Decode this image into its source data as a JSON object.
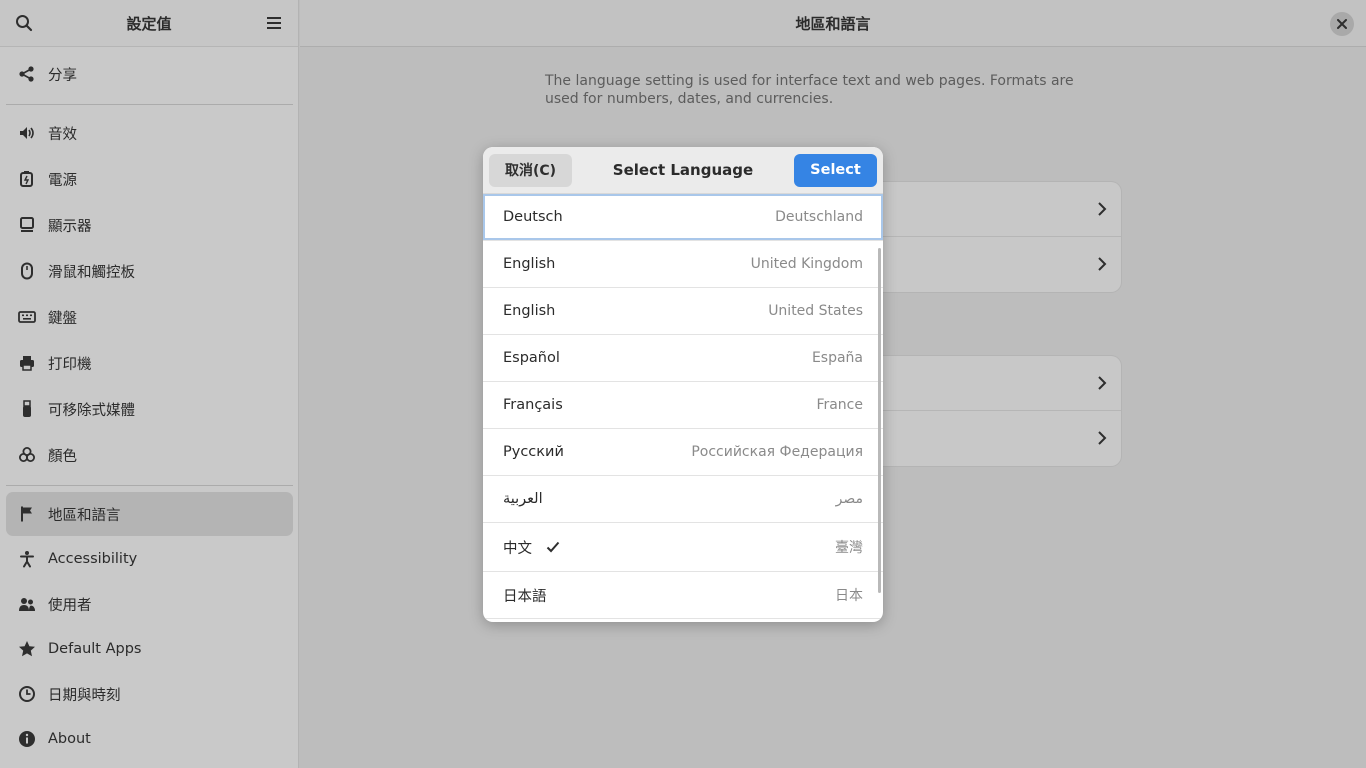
{
  "sidebar": {
    "title": "設定值",
    "items": [
      {
        "label": "分享",
        "icon": "share-icon"
      },
      {
        "label": "音效",
        "icon": "speaker-icon"
      },
      {
        "label": "電源",
        "icon": "battery-icon"
      },
      {
        "label": "顯示器",
        "icon": "display-icon"
      },
      {
        "label": "滑鼠和觸控板",
        "icon": "mouse-icon"
      },
      {
        "label": "鍵盤",
        "icon": "keyboard-icon"
      },
      {
        "label": "打印機",
        "icon": "printer-icon"
      },
      {
        "label": "可移除式媒體",
        "icon": "usb-icon"
      },
      {
        "label": "顏色",
        "icon": "color-icon"
      },
      {
        "label": "地區和語言",
        "icon": "flag-icon"
      },
      {
        "label": "Accessibility",
        "icon": "accessibility-icon"
      },
      {
        "label": "使用者",
        "icon": "users-icon"
      },
      {
        "label": "Default Apps",
        "icon": "star-icon"
      },
      {
        "label": "日期與時刻",
        "icon": "clock-icon"
      },
      {
        "label": "About",
        "icon": "info-icon"
      }
    ],
    "active_item": "地區和語言"
  },
  "main": {
    "title": "地區和語言",
    "description": "The language setting is used for interface text and web pages. Formats are used for numbers, dates, and currencies."
  },
  "dialog": {
    "cancel_label": "取消(C)",
    "title": "Select Language",
    "select_label": "Select",
    "languages": [
      {
        "name": "Deutsch",
        "region": "Deutschland"
      },
      {
        "name": "English",
        "region": "United Kingdom"
      },
      {
        "name": "English",
        "region": "United States"
      },
      {
        "name": "Español",
        "region": "España"
      },
      {
        "name": "Français",
        "region": "France"
      },
      {
        "name": "Русский",
        "region": "Российская Федерация"
      },
      {
        "name": "العربية",
        "region": "مصر"
      },
      {
        "name": "中文",
        "region": "臺灣"
      },
      {
        "name": "日本語",
        "region": "日本"
      }
    ],
    "selected_language": "中文",
    "focused_language": "Deutsch"
  },
  "colors": {
    "accent": "#3584e4",
    "sidebar_bg": "#c9c9c9",
    "sidebar_active": "#b4b4b4",
    "dialog_bg": "#ffffff"
  }
}
